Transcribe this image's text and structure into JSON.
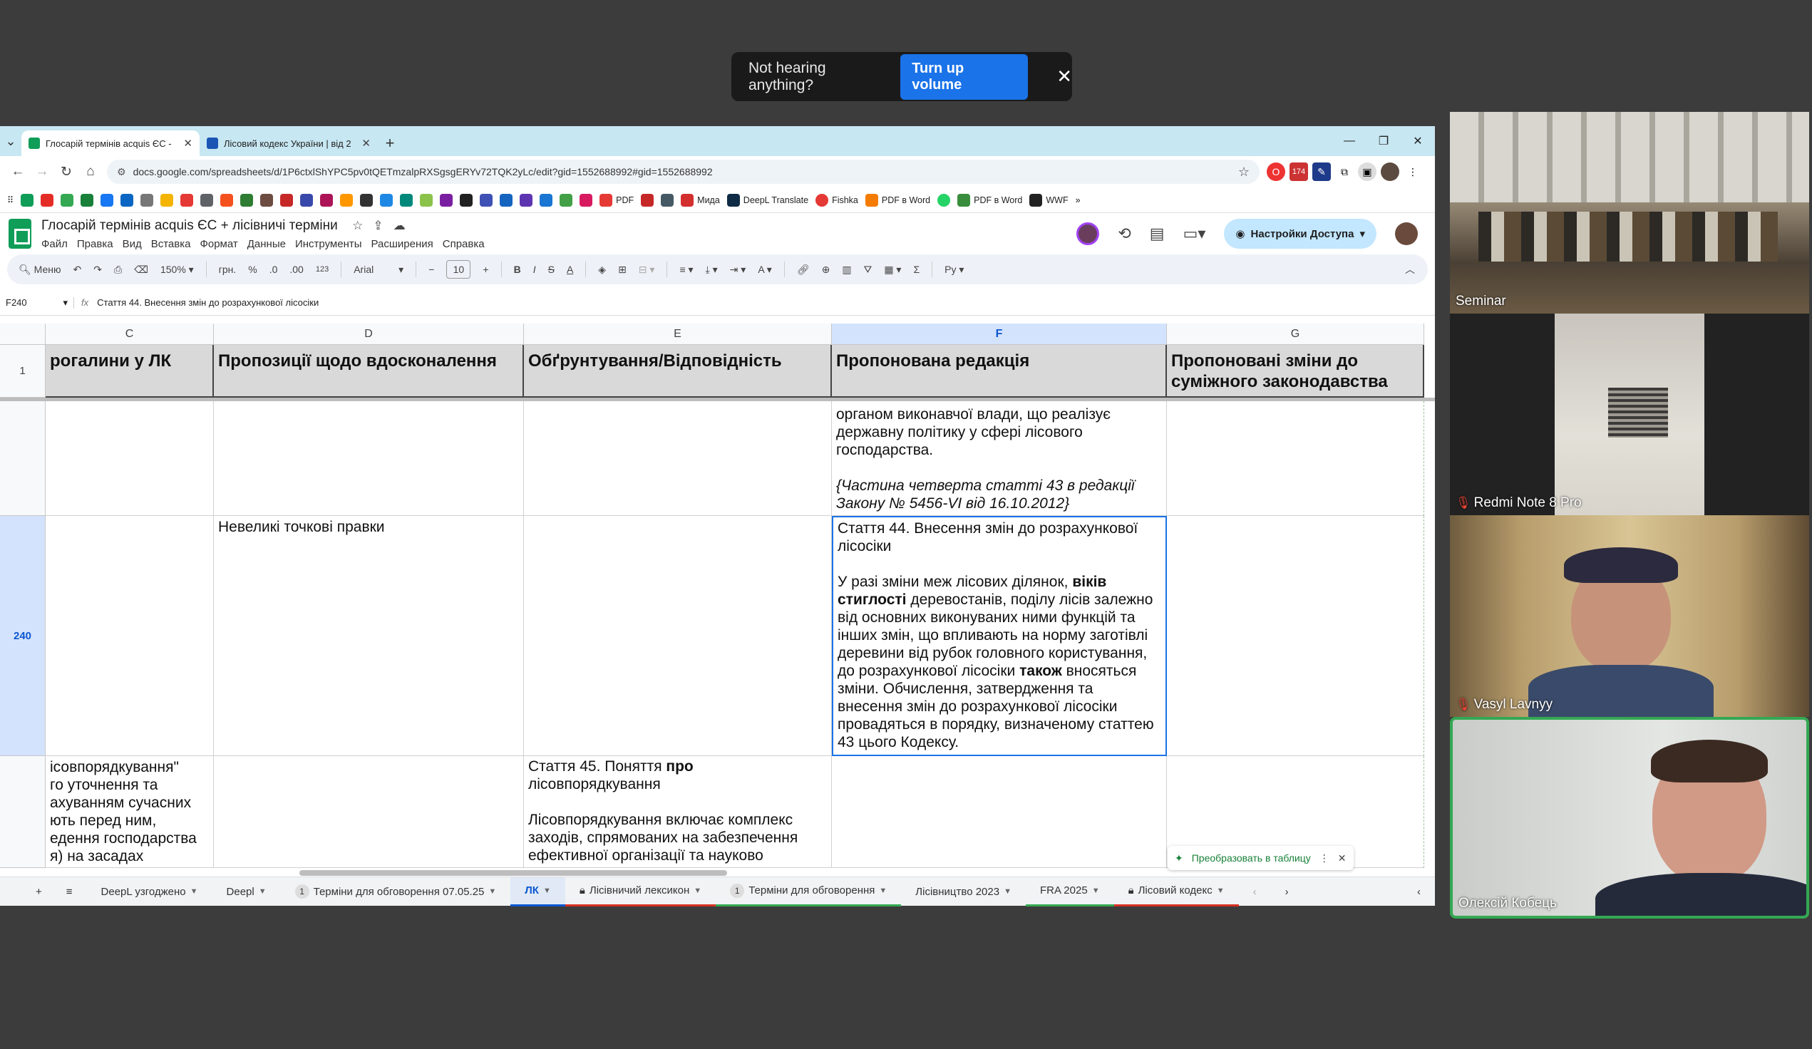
{
  "toast": {
    "message": "Not hearing anything?",
    "button": "Turn up volume",
    "close": "✕"
  },
  "browser": {
    "tabs": [
      {
        "title": "Глосарій термінів acquis ЄС -",
        "close": "✕",
        "color": "#0f9d58"
      },
      {
        "title": "Лісовий кодекс України | від 2",
        "close": "✕",
        "color": "#1a55b5"
      }
    ],
    "new_tab": "+",
    "url": "docs.google.com/spreadsheets/d/1P6ctxlShYPC5pv0tQETmzalpRXSgsgERYv72TQK2yLc/edit?gid=1552688992#gid=1552688992",
    "bookmarks": [
      "PDF",
      "Мида",
      "DeepL Translate",
      "Fishka",
      "PDF в Word",
      "PDF в Word",
      "WWF"
    ],
    "ext_badge": "174"
  },
  "sheets": {
    "title": "Глосарій термінів acquis ЄС + лісівничі терміни",
    "menus": [
      "Файл",
      "Правка",
      "Вид",
      "Вставка",
      "Формат",
      "Данные",
      "Инструменты",
      "Расширения",
      "Справка"
    ],
    "share_label": "Настройки Доступа",
    "toolbar": {
      "menu": "Меню",
      "zoom": "150%",
      "currency": "грн.",
      "percent": "%",
      "dec_minus": ".0",
      "dec_plus": ".00",
      "number_fmt": "123",
      "font": "Arial",
      "font_size": "10",
      "more": "Ру"
    },
    "formula": {
      "cell_ref": "F240",
      "content": "Стаття 44. Внесення змін до розрахункової лісосіки"
    },
    "columns": [
      "C",
      "D",
      "E",
      "F",
      "G"
    ],
    "header_row": {
      "num": "1",
      "C": "рогалини у ЛК",
      "D": "Пропозиції щодо вдосконалення",
      "E": "Обґрунтування/Відповідність",
      "F": "Пропонована редакція",
      "G": "Пропоновані зміни до суміжного законодавства"
    },
    "row_prev": {
      "F_text": "органом виконавчої влади, що реалізує державну політику у сфері лісового господарства.",
      "F_note": "{Частина четверта статті 43 в редакції Закону № 5456-VI від 16.10.2012}"
    },
    "row_240": {
      "num": "240",
      "D": "Невеликі точкові правки",
      "F_title": "Стаття 44. Внесення змін до розрахункової лісосіки",
      "F_body_1": "У разі зміни меж лісових ділянок, ",
      "F_bold_1": "віків стиглості",
      "F_body_2": " деревостанів, поділу лісів залежно від основних виконуваних ними функцій та інших змін, що впливають на норму заготівлі деревини від рубок головного користування, до розрахункової лісосіки ",
      "F_bold_2": "також",
      "F_body_3": " вносяться зміни. Обчислення, затвердження та внесення змін до розрахункової лісосіки провадяться в порядку, визначеному статтею 43 цього Кодексу."
    },
    "row_next": {
      "C": "ісовпорядкування\"\nго уточнення та\nахуванням сучасних\nють перед ним,\nедення господарства\nя) на засадах",
      "E_a": "Стаття 45. Поняття ",
      "E_bold": "про",
      "E_b": "\nлісовпорядкування\n\nЛісовпорядкування включає комплекс заходів, спрямованих на забезпечення ефективної організації та науково"
    },
    "convert_chip": "Преобразовать в таблицу",
    "sheet_tabs": [
      {
        "label": "DeepL узгоджено"
      },
      {
        "label": "Deepl"
      },
      {
        "label": "Терміни для обговорення 07.05.25",
        "badge": "1"
      },
      {
        "label": "ЛК",
        "active": true
      },
      {
        "label": "Лісівничий лексикон",
        "locked": true
      },
      {
        "label": "Терміни для обговорення",
        "badge": "1"
      },
      {
        "label": "Лісівництво 2023"
      },
      {
        "label": "FRA 2025"
      },
      {
        "label": "Лісовий кодекс",
        "locked": true
      }
    ]
  },
  "participants": [
    {
      "name": "Seminar",
      "muted": false
    },
    {
      "name": "Redmi Note 8 Pro",
      "muted": true
    },
    {
      "name": "Vasyl Lavnyy",
      "muted": true
    },
    {
      "name": "Олексій Кобець",
      "muted": false,
      "speaking": true
    }
  ]
}
